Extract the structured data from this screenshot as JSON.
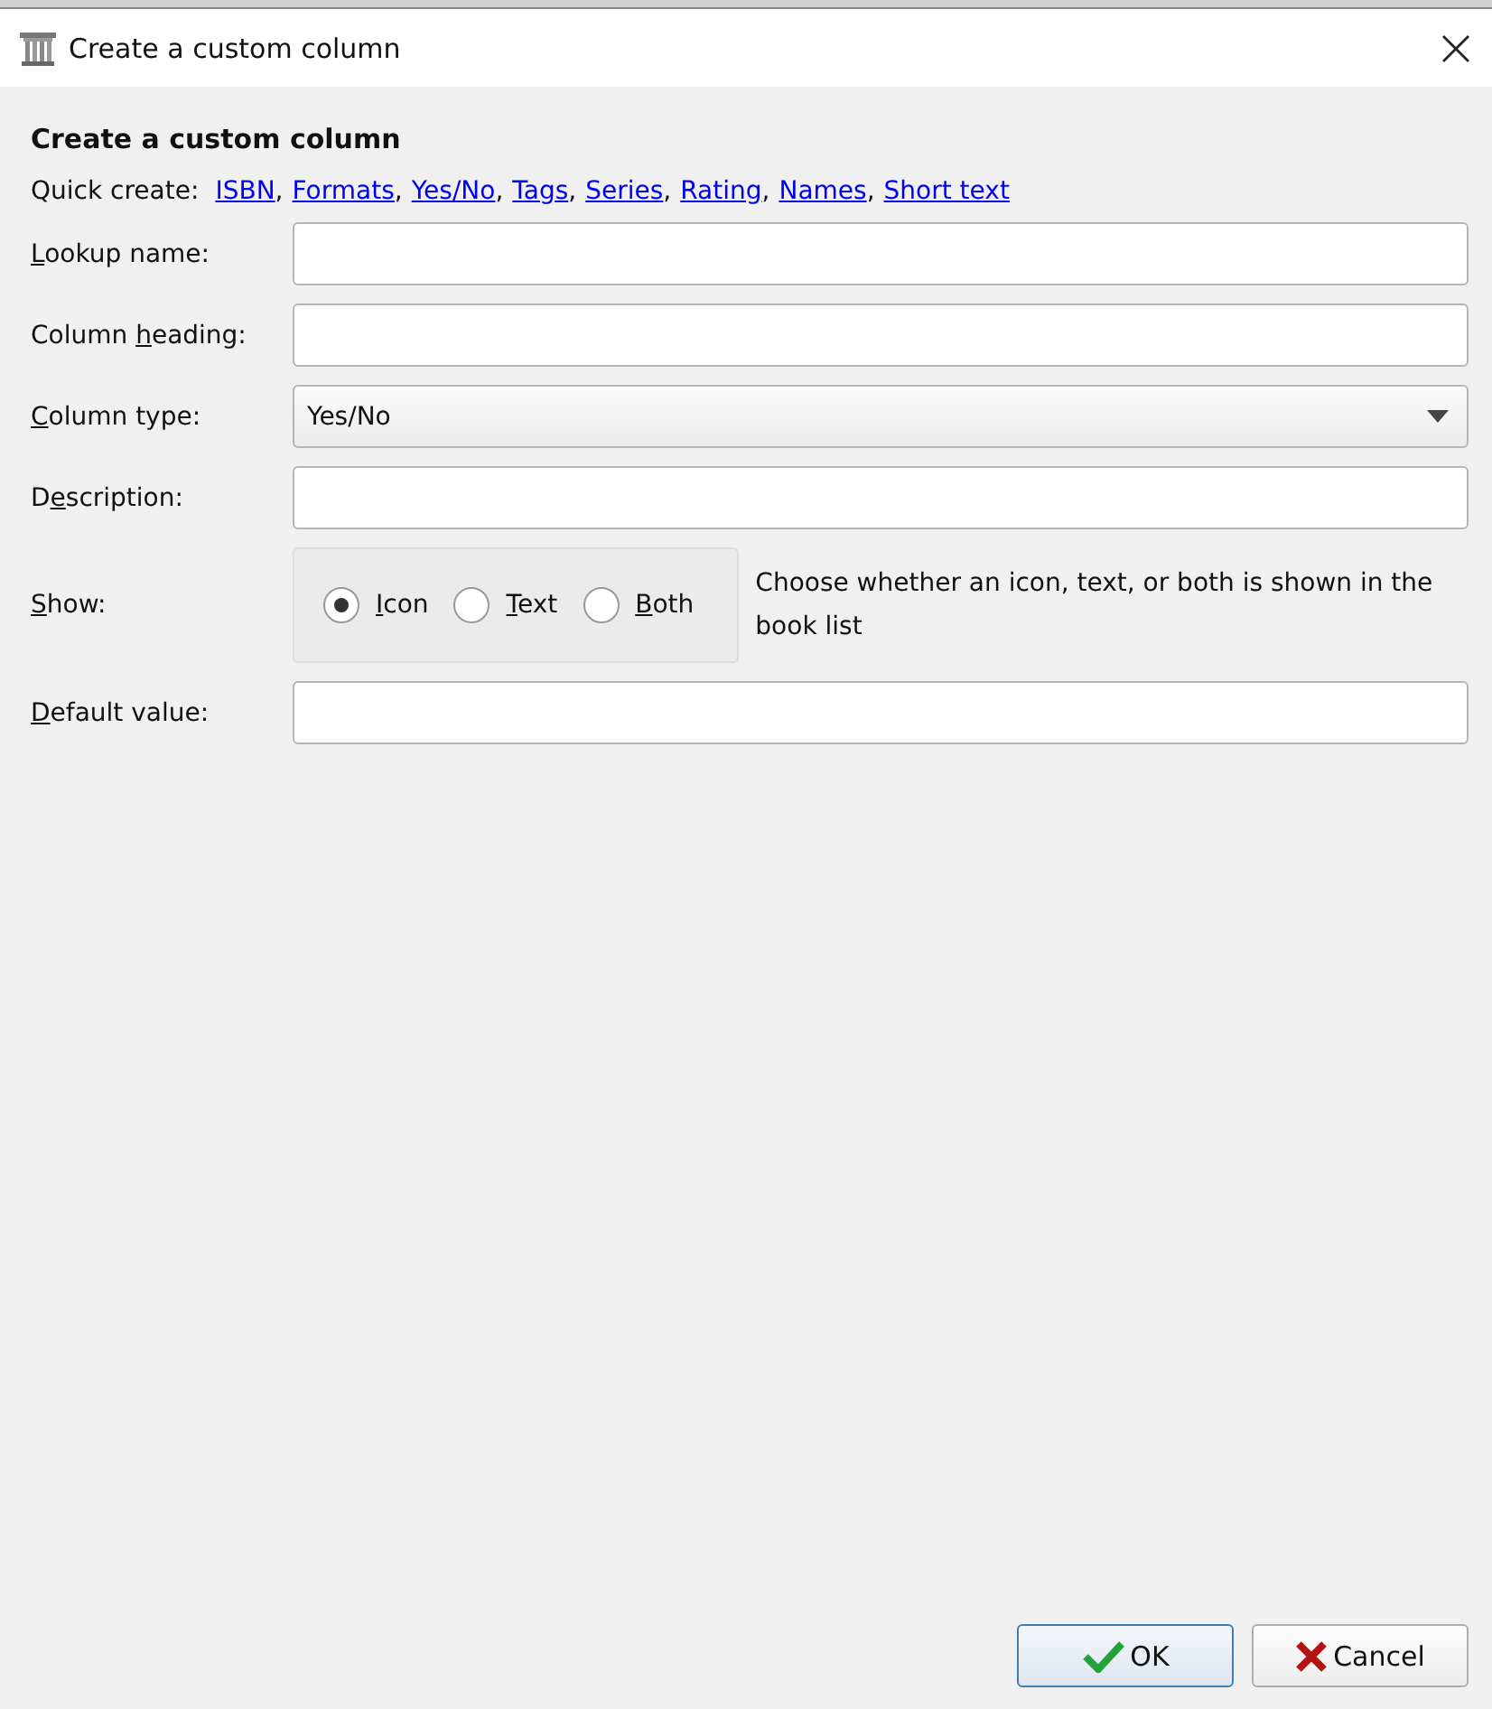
{
  "window": {
    "title": "Create a custom column"
  },
  "heading": "Create a custom column",
  "quick_create": {
    "label": "Quick create:",
    "links": [
      {
        "text": "ISBN",
        "sep": ","
      },
      {
        "text": "Formats",
        "sep": ","
      },
      {
        "text": "Yes/No",
        "sep": ","
      },
      {
        "text": "Tags",
        "sep": ","
      },
      {
        "text": "Series",
        "sep": ","
      },
      {
        "text": "Rating",
        "sep": ","
      },
      {
        "text": "Names",
        "sep": ","
      },
      {
        "text": "Short text"
      }
    ]
  },
  "fields": [
    {
      "kind": "text",
      "label": {
        "key": "L",
        "post": "ookup name:"
      }
    },
    {
      "kind": "text",
      "label": {
        "pre": "Column ",
        "key": "h",
        "post": "eading:"
      }
    },
    {
      "kind": "dropdown",
      "label": {
        "key": "C",
        "post": "olumn type:"
      },
      "value": "Yes/No"
    },
    {
      "kind": "text",
      "label": {
        "pre": "D",
        "key": "e",
        "post": "scription:"
      }
    },
    {
      "kind": "radios",
      "label": {
        "key": "S",
        "post": "how:"
      },
      "options": [
        {
          "label": {
            "key": "I",
            "post": "con"
          },
          "selected": true
        },
        {
          "label": {
            "key": "T",
            "post": "ext"
          },
          "selected": false
        },
        {
          "label": {
            "key": "B",
            "post": "oth"
          },
          "selected": false
        }
      ],
      "hint": "Choose whether an icon, text, or both is shown in the book list"
    },
    {
      "kind": "text",
      "label": {
        "key": "D",
        "post": "efault value:"
      }
    }
  ],
  "buttons": [
    {
      "kind": "ok",
      "label": "OK",
      "default": true
    },
    {
      "kind": "cancel",
      "label": "Cancel",
      "default": false
    }
  ]
}
